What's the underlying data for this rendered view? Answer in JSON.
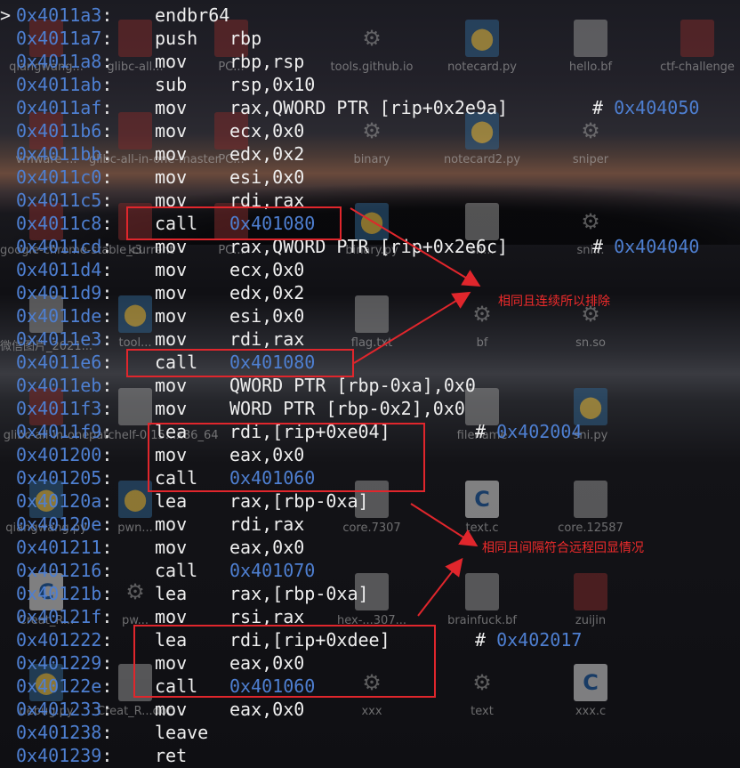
{
  "desktop_icons": [
    {
      "label": "qiangwang...",
      "kind": "folder",
      "col": 0,
      "row": 0
    },
    {
      "label": "glibc-all...",
      "kind": "folder",
      "col": 1,
      "row": 0
    },
    {
      "label": "PC...",
      "kind": "folder",
      "col": 2,
      "row": 0
    },
    {
      "label": "tools.github.io",
      "kind": "gear",
      "col": 3,
      "row": 0
    },
    {
      "label": "notecard.py",
      "kind": "python",
      "col": 4,
      "row": 0
    },
    {
      "label": "hello.bf",
      "kind": "doc",
      "col": 5,
      "row": 0
    },
    {
      "label": "ctf-challenge",
      "kind": "folder",
      "col": 6,
      "row": 0
    },
    {
      "label": "vmware-...",
      "kind": "folder",
      "col": 0,
      "row": 1
    },
    {
      "label": "glibc-all-in-one-master",
      "kind": "folder",
      "col": 1,
      "row": 1
    },
    {
      "label": "PC...",
      "kind": "folder",
      "col": 2,
      "row": 1
    },
    {
      "label": "binary",
      "kind": "gear",
      "col": 3,
      "row": 1
    },
    {
      "label": "notecard2.py",
      "kind": "python",
      "col": 4,
      "row": 1
    },
    {
      "label": "sniper",
      "kind": "gear",
      "col": 5,
      "row": 1
    },
    {
      "label": "google-chrome-stable_current",
      "kind": "folder",
      "col": 0,
      "row": 2
    },
    {
      "label": "k3",
      "kind": "folder",
      "col": 1,
      "row": 2
    },
    {
      "label": "PC...",
      "kind": "folder",
      "col": 2,
      "row": 2
    },
    {
      "label": "binary.py",
      "kind": "python",
      "col": 3,
      "row": 2
    },
    {
      "label": "sn...",
      "kind": "doc",
      "col": 4,
      "row": 2
    },
    {
      "label": "sni...",
      "kind": "gear",
      "col": 5,
      "row": 2
    },
    {
      "label": "微信图片_2021...",
      "kind": "doc",
      "col": 0,
      "row": 3
    },
    {
      "label": "tool...",
      "kind": "python",
      "col": 1,
      "row": 3
    },
    {
      "label": "flag.txt",
      "kind": "doc",
      "col": 3,
      "row": 3
    },
    {
      "label": "bf",
      "kind": "gear",
      "col": 4,
      "row": 3
    },
    {
      "label": "sn.so",
      "kind": "gear",
      "col": 5,
      "row": 3
    },
    {
      "label": "glibc-all-in-one",
      "kind": "folder",
      "col": 0,
      "row": 4
    },
    {
      "label": "patchelf-0.15...x86_64",
      "kind": "doc",
      "col": 1,
      "row": 4
    },
    {
      "label": "filename",
      "kind": "doc",
      "col": 4,
      "row": 4
    },
    {
      "label": "sni.py",
      "kind": "python",
      "col": 5,
      "row": 4
    },
    {
      "label": "qiangwang.py",
      "kind": "python",
      "col": 0,
      "row": 5
    },
    {
      "label": "pwn...",
      "kind": "python",
      "col": 1,
      "row": 5
    },
    {
      "label": "core.7307",
      "kind": "doc",
      "col": 3,
      "row": 5
    },
    {
      "label": "text.c",
      "kind": "c",
      "col": 4,
      "row": 5
    },
    {
      "label": "core.12587",
      "kind": "doc",
      "col": 5,
      "row": 5
    },
    {
      "label": "Creat_R...",
      "kind": "c",
      "col": 0,
      "row": 6
    },
    {
      "label": "pw...",
      "kind": "gear",
      "col": 1,
      "row": 6
    },
    {
      "label": "hex-...307...",
      "kind": "doc",
      "col": 3,
      "row": 6
    },
    {
      "label": "brainfuck.bf",
      "kind": "doc",
      "col": 4,
      "row": 6
    },
    {
      "label": "zuijin",
      "kind": "folder",
      "col": 5,
      "row": 6
    },
    {
      "label": "debug.py",
      "kind": "python",
      "col": 0,
      "row": 7
    },
    {
      "label": "Creat_R...doc",
      "kind": "doc",
      "col": 1,
      "row": 7
    },
    {
      "label": "xxx",
      "kind": "gear",
      "col": 3,
      "row": 7
    },
    {
      "label": "text",
      "kind": "gear",
      "col": 4,
      "row": 7
    },
    {
      "label": "xxx.c",
      "kind": "c",
      "col": 5,
      "row": 7
    }
  ],
  "terminal": {
    "prompt_glyph": ">",
    "lines": [
      {
        "addr": "0x4011a3",
        "mn": "endbr64",
        "op": "",
        "cmt": "",
        "cmt_addr": ""
      },
      {
        "addr": "0x4011a7",
        "mn": "push",
        "op": "rbp",
        "cmt": "",
        "cmt_addr": ""
      },
      {
        "addr": "0x4011a8",
        "mn": "mov",
        "op": "rbp,rsp",
        "cmt": "",
        "cmt_addr": ""
      },
      {
        "addr": "0x4011ab",
        "mn": "sub",
        "op": "rsp,0x10",
        "cmt": "",
        "cmt_addr": ""
      },
      {
        "addr": "0x4011af",
        "mn": "mov",
        "op": "rax,QWORD PTR [rip+0x2e9a]",
        "cmt": "#",
        "cmt_addr": "0x404050"
      },
      {
        "addr": "0x4011b6",
        "mn": "mov",
        "op": "ecx,0x0",
        "cmt": "",
        "cmt_addr": ""
      },
      {
        "addr": "0x4011bb",
        "mn": "mov",
        "op": "edx,0x2",
        "cmt": "",
        "cmt_addr": ""
      },
      {
        "addr": "0x4011c0",
        "mn": "mov",
        "op": "esi,0x0",
        "cmt": "",
        "cmt_addr": ""
      },
      {
        "addr": "0x4011c5",
        "mn": "mov",
        "op": "rdi,rax",
        "cmt": "",
        "cmt_addr": ""
      },
      {
        "addr": "0x4011c8",
        "mn": "call",
        "op": "0x401080",
        "cmt": "",
        "cmt_addr": "",
        "target": true
      },
      {
        "addr": "0x4011cd",
        "mn": "mov",
        "op": "rax,QWORD PTR [rip+0x2e6c]",
        "cmt": "#",
        "cmt_addr": "0x404040"
      },
      {
        "addr": "0x4011d4",
        "mn": "mov",
        "op": "ecx,0x0",
        "cmt": "",
        "cmt_addr": ""
      },
      {
        "addr": "0x4011d9",
        "mn": "mov",
        "op": "edx,0x2",
        "cmt": "",
        "cmt_addr": ""
      },
      {
        "addr": "0x4011de",
        "mn": "mov",
        "op": "esi,0x0",
        "cmt": "",
        "cmt_addr": ""
      },
      {
        "addr": "0x4011e3",
        "mn": "mov",
        "op": "rdi,rax",
        "cmt": "",
        "cmt_addr": ""
      },
      {
        "addr": "0x4011e6",
        "mn": "call",
        "op": "0x401080",
        "cmt": "",
        "cmt_addr": "",
        "target": true
      },
      {
        "addr": "0x4011eb",
        "mn": "mov",
        "op": "QWORD PTR [rbp-0xa],0x0",
        "cmt": "",
        "cmt_addr": ""
      },
      {
        "addr": "0x4011f3",
        "mn": "mov",
        "op": "WORD PTR [rbp-0x2],0x0",
        "cmt": "",
        "cmt_addr": ""
      },
      {
        "addr": "0x4011f9",
        "mn": "lea",
        "op": "rdi,[rip+0xe04]",
        "cmt": "#",
        "cmt_addr": "0x402004"
      },
      {
        "addr": "0x401200",
        "mn": "mov",
        "op": "eax,0x0",
        "cmt": "",
        "cmt_addr": ""
      },
      {
        "addr": "0x401205",
        "mn": "call",
        "op": "0x401060",
        "cmt": "",
        "cmt_addr": "",
        "target": true
      },
      {
        "addr": "0x40120a",
        "mn": "lea",
        "op": "rax,[rbp-0xa]",
        "cmt": "",
        "cmt_addr": ""
      },
      {
        "addr": "0x40120e",
        "mn": "mov",
        "op": "rdi,rax",
        "cmt": "",
        "cmt_addr": ""
      },
      {
        "addr": "0x401211",
        "mn": "mov",
        "op": "eax,0x0",
        "cmt": "",
        "cmt_addr": ""
      },
      {
        "addr": "0x401216",
        "mn": "call",
        "op": "0x401070",
        "cmt": "",
        "cmt_addr": "",
        "target": true
      },
      {
        "addr": "0x40121b",
        "mn": "lea",
        "op": "rax,[rbp-0xa]",
        "cmt": "",
        "cmt_addr": ""
      },
      {
        "addr": "0x40121f",
        "mn": "mov",
        "op": "rsi,rax",
        "cmt": "",
        "cmt_addr": ""
      },
      {
        "addr": "0x401222",
        "mn": "lea",
        "op": "rdi,[rip+0xdee]",
        "cmt": "#",
        "cmt_addr": "0x402017"
      },
      {
        "addr": "0x401229",
        "mn": "mov",
        "op": "eax,0x0",
        "cmt": "",
        "cmt_addr": ""
      },
      {
        "addr": "0x40122e",
        "mn": "call",
        "op": "0x401060",
        "cmt": "",
        "cmt_addr": "",
        "target": true
      },
      {
        "addr": "0x401233",
        "mn": "mov",
        "op": "eax,0x0",
        "cmt": "",
        "cmt_addr": ""
      },
      {
        "addr": "0x401238",
        "mn": "leave",
        "op": "",
        "cmt": "",
        "cmt_addr": ""
      },
      {
        "addr": "0x401239",
        "mn": "ret",
        "op": "",
        "cmt": "",
        "cmt_addr": ""
      }
    ]
  },
  "annotations": {
    "note_1": "相同且连续所以排除",
    "note_2": "相同且间隔符合远程回显情况"
  },
  "colors": {
    "address": "#4e7fd1",
    "text": "#efefef",
    "annotation": "#e0262c"
  }
}
